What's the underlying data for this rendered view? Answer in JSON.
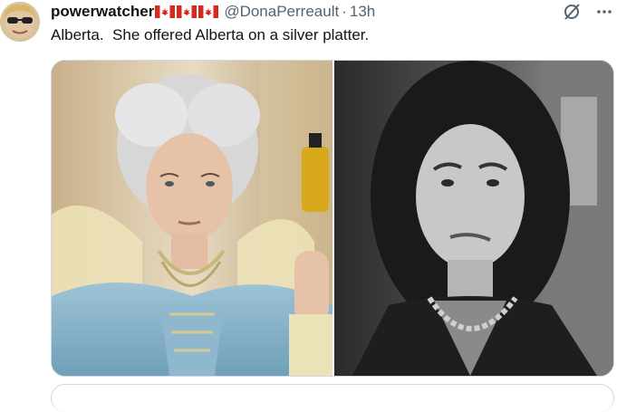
{
  "tweet": {
    "display_name": "powerwatcher",
    "flags": [
      "canada-flag",
      "canada-flag",
      "canada-flag"
    ],
    "handle": "@DonaPerreault",
    "separator": "·",
    "time": "13h",
    "text": "Alberta.  She offered Alberta on a silver platter."
  },
  "icons": {
    "grok": "grok-icon",
    "more": "more-icon"
  },
  "media": {
    "images": [
      {
        "name": "rococo-queen-photo"
      },
      {
        "name": "woman-grayscale-photo"
      }
    ]
  },
  "colors": {
    "text": "#0f1419",
    "secondary": "#536471",
    "border": "#cfd9de",
    "flag_red": "#d52b1e"
  }
}
